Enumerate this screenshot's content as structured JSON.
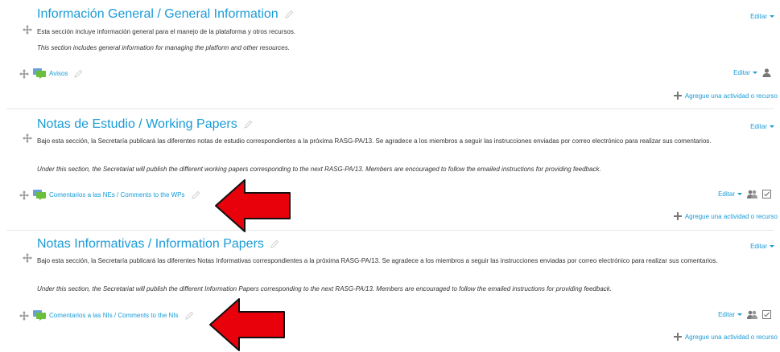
{
  "edit_label": "Editar",
  "add_label": "Agregue una actividad o recurso",
  "sections": [
    {
      "title": "Información General / General Information",
      "desc_es": "Esta sección incluye información general para el manejo de la plataforma y otros recursos.",
      "desc_en": "This section includes general information for managing the platform and other resources.",
      "activity": "Avisos"
    },
    {
      "title": "Notas de Estudio / Working Papers",
      "desc_es": "Bajo esta sección, la Secretaría publicará las diferentes notas de estudio correspondientes a la próxima RASG-PA/13. Se agradece a los  miembros a seguir las instrucciones enviadas por correo electrónico para realizar sus comentarios.",
      "desc_en": "Under this section, the Secretariat will publish the different working papers corresponding to the next RASG-PA/13. Members are encouraged to follow the emailed instructions for providing feedback.",
      "activity": "Comentarios a las NEs / Comments to the WPs"
    },
    {
      "title": "Notas Informativas / Information Papers",
      "desc_es": "Bajo esta sección, la Secretaría publicará las diferentes Notas Informativas correspondientes a la próxima RASG-PA/13. Se agradece a los  miembros a seguir las instrucciones enviadas por correo electrónico para realizar sus comentarios.",
      "desc_en": "Under this section, the Secretariat will publish the different Information Papers corresponding to the next RASG-PA/13. Members are encouraged to follow the emailed instructions for providing feedback.",
      "activity": "Comentarios a las NIs / Comments to the NIs"
    }
  ],
  "colors": {
    "link": "#1a9bd7",
    "arrow": "#e8000b",
    "forum_icon": "#6cbf3a"
  },
  "icons": [
    "move-icon",
    "pencil-icon",
    "forum-icon",
    "user-icon",
    "group-icon",
    "checkbox-icon",
    "plus-icon",
    "red-arrow-icon"
  ]
}
